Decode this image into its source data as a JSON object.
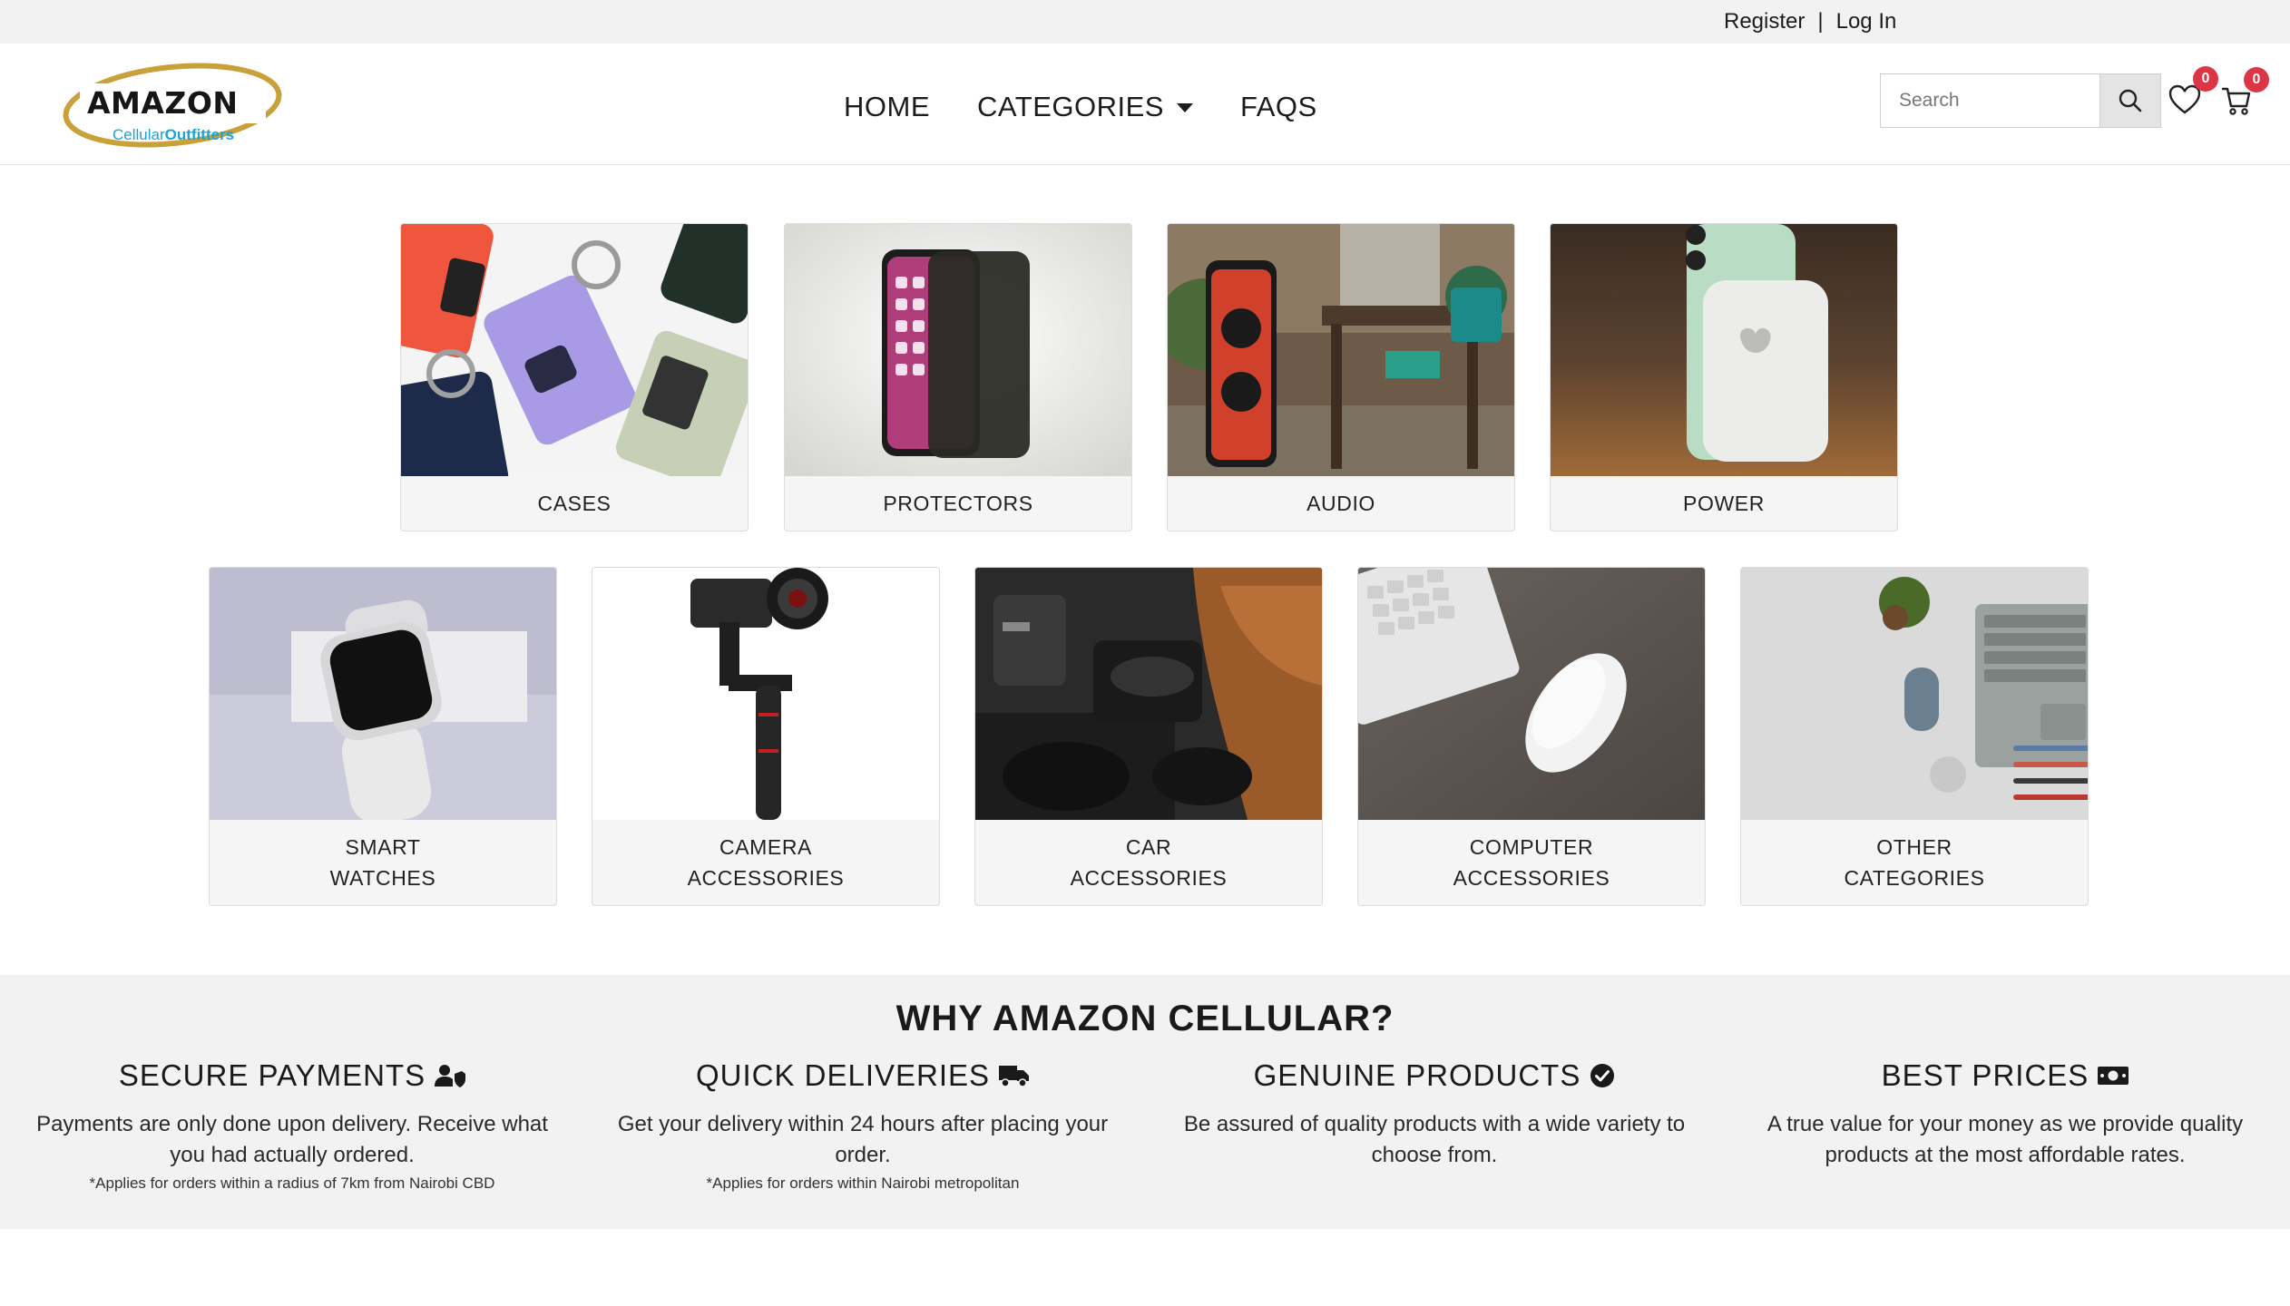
{
  "topbar": {
    "register": "Register",
    "separator": "|",
    "login": "Log In"
  },
  "logo": {
    "word": "AMAZON",
    "sub_light": "Cellular",
    "sub_bold": "Outfitters"
  },
  "nav": {
    "home": "HOME",
    "categories": "CATEGORIES",
    "faqs": "FAQS"
  },
  "search": {
    "placeholder": "Search"
  },
  "wishlist": {
    "count": "0"
  },
  "cart": {
    "count": "0"
  },
  "categories_row1": [
    {
      "label": "CASES"
    },
    {
      "label": "PROTECTORS"
    },
    {
      "label": "AUDIO"
    },
    {
      "label": "POWER"
    }
  ],
  "categories_row2": [
    {
      "line1": "SMART",
      "line2": "WATCHES"
    },
    {
      "line1": "CAMERA",
      "line2": "ACCESSORIES"
    },
    {
      "line1": "CAR",
      "line2": "ACCESSORIES"
    },
    {
      "line1": "COMPUTER",
      "line2": "ACCESSORIES"
    },
    {
      "line1": "OTHER",
      "line2": "CATEGORIES"
    }
  ],
  "why": {
    "title": "WHY AMAZON CELLULAR?",
    "features": [
      {
        "title": "SECURE PAYMENTS",
        "desc": "Payments are only done upon delivery. Receive what you had actually ordered.",
        "note": "*Applies for orders within a radius of 7km from Nairobi CBD",
        "icon": "user-shield-icon"
      },
      {
        "title": "QUICK DELIVERIES",
        "desc": "Get your delivery within 24 hours after placing your order.",
        "note": "*Applies for orders within Nairobi metropolitan",
        "icon": "truck-icon"
      },
      {
        "title": "GENUINE PRODUCTS",
        "desc": "Be assured of quality products with a wide variety to choose from.",
        "note": "",
        "icon": "check-circle-icon"
      },
      {
        "title": "BEST PRICES",
        "desc": "A true value for your money as we provide quality products at the most affordable rates.",
        "note": "",
        "icon": "money-bill-icon"
      }
    ]
  },
  "colors": {
    "badge": "#dc3545",
    "logo_swoosh": "#c9a13a",
    "logo_sub": "#1aa3d9",
    "section_bg": "#f2f2f2"
  }
}
